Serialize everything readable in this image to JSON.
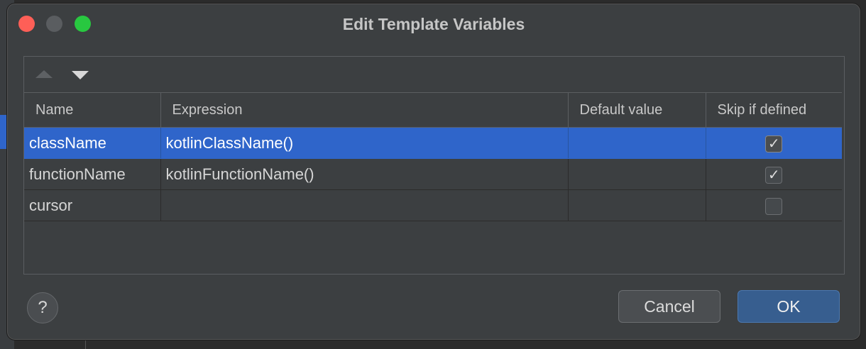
{
  "dialog": {
    "title": "Edit Template Variables"
  },
  "toolbar": {
    "move_up_icon": "triangle-up",
    "move_down_icon": "triangle-down"
  },
  "table": {
    "columns": [
      "Name",
      "Expression",
      "Default value",
      "Skip if defined"
    ],
    "rows": [
      {
        "name": "className",
        "expression": "kotlinClassName()",
        "default": "",
        "skip": true,
        "selected": true
      },
      {
        "name": "functionName",
        "expression": "kotlinFunctionName()",
        "default": "",
        "skip": true,
        "selected": false
      },
      {
        "name": "cursor",
        "expression": "",
        "default": "",
        "skip": false,
        "selected": false
      }
    ]
  },
  "buttons": {
    "help": "?",
    "cancel": "Cancel",
    "ok": "OK"
  },
  "colors": {
    "selection": "#2f65ca",
    "dialog_bg": "#3c3f41",
    "ok_button": "#375e8f"
  }
}
